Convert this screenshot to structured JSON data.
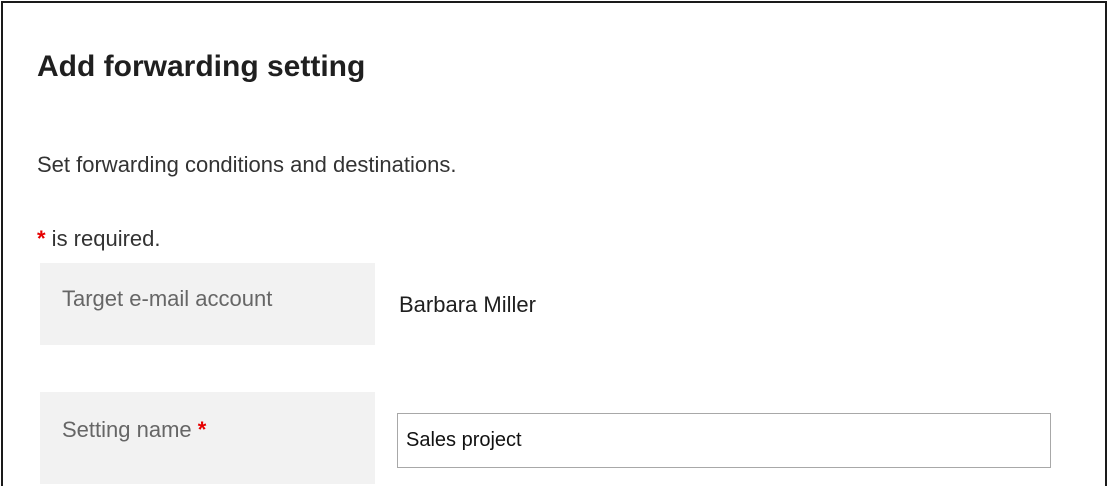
{
  "page": {
    "title": "Add forwarding setting",
    "description": "Set forwarding conditions and destinations.",
    "required_marker": "*",
    "required_note": " is required."
  },
  "form": {
    "target_account": {
      "label": "Target e-mail account",
      "value": "Barbara Miller"
    },
    "setting_name": {
      "label": "Setting name ",
      "required_marker": "*",
      "value": "Sales project",
      "placeholder": ""
    }
  },
  "colors": {
    "required_marker": "#e60000",
    "label_background": "#f2f2f2",
    "input_border": "#a8a8a8"
  }
}
